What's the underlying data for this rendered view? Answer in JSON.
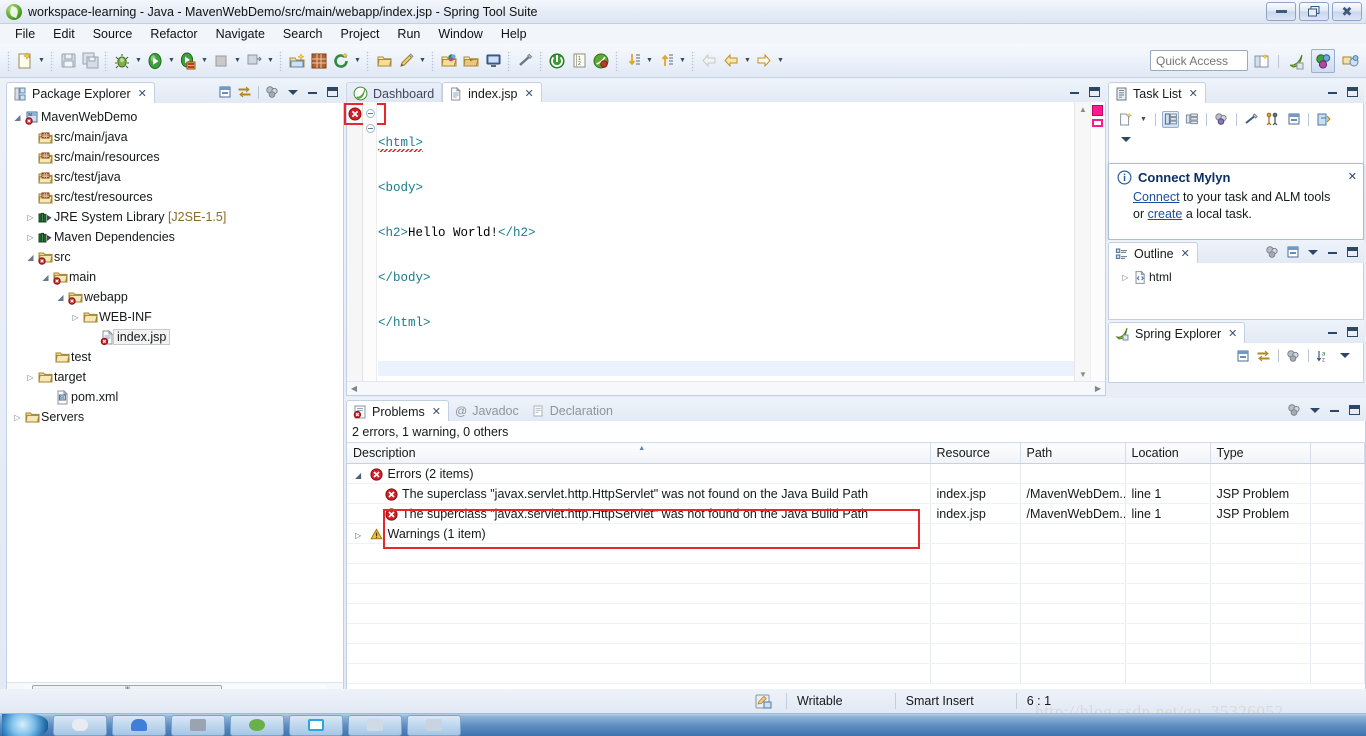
{
  "window": {
    "title": "workspace-learning - Java - MavenWebDemo/src/main/webapp/index.jsp - Spring Tool Suite",
    "app_icon": "spring-leaf-icon",
    "controls": {
      "minimize": "minimize-button",
      "maximize": "maximize-button",
      "close": "close-button"
    }
  },
  "menubar": {
    "items": [
      {
        "label": "File"
      },
      {
        "label": "Edit"
      },
      {
        "label": "Source"
      },
      {
        "label": "Refactor"
      },
      {
        "label": "Navigate"
      },
      {
        "label": "Search"
      },
      {
        "label": "Project"
      },
      {
        "label": "Run"
      },
      {
        "label": "Window"
      },
      {
        "label": "Help"
      }
    ]
  },
  "toolbar": {
    "quick_access_placeholder": "Quick Access",
    "buttons": [
      {
        "name": "new-wizard-icon",
        "has_dropdown": true
      },
      {
        "name": "save-icon",
        "has_dropdown": false
      },
      {
        "name": "save-all-icon",
        "has_dropdown": false
      },
      {
        "name": "debug-icon",
        "has_dropdown": true
      },
      {
        "name": "run-icon",
        "has_dropdown": true
      },
      {
        "name": "run-on-server-icon",
        "has_dropdown": true
      },
      {
        "name": "stop-icon",
        "has_dropdown": true
      },
      {
        "name": "publish-icon",
        "has_dropdown": true
      },
      {
        "name": "new-java-package-icon",
        "has_dropdown": false
      },
      {
        "name": "new-java-class-icon",
        "has_dropdown": false
      },
      {
        "name": "refresh-icon",
        "has_dropdown": true
      },
      {
        "name": "open-type-icon",
        "has_dropdown": false
      },
      {
        "name": "pencil-edit-icon",
        "has_dropdown": true
      },
      {
        "name": "open-resource-icon",
        "has_dropdown": false
      },
      {
        "name": "open-task-icon",
        "has_dropdown": false
      },
      {
        "name": "console-icon",
        "has_dropdown": false
      },
      {
        "name": "toggle-mark-occurrences-icon",
        "has_dropdown": false
      },
      {
        "name": "terminate-icon",
        "has_dropdown": false
      },
      {
        "name": "bookmark-icon",
        "has_dropdown": false
      },
      {
        "name": "spring-bean-icon",
        "has_dropdown": false
      },
      {
        "name": "next-annotation-icon",
        "has_dropdown": true
      },
      {
        "name": "previous-annotation-icon",
        "has_dropdown": true
      },
      {
        "name": "back-disabled-icon",
        "has_dropdown": false
      },
      {
        "name": "back-icon",
        "has_dropdown": true
      },
      {
        "name": "forward-icon",
        "has_dropdown": true
      }
    ],
    "perspectives": [
      {
        "name": "open-perspective-icon",
        "active": false
      },
      {
        "name": "spring-perspective-icon",
        "active": false
      },
      {
        "name": "java-perspective-icon",
        "active": true
      },
      {
        "name": "java-ee-perspective-icon",
        "active": false
      }
    ]
  },
  "package_explorer": {
    "title": "Package Explorer",
    "tools": [
      "collapse-all-icon",
      "link-with-editor-icon",
      "view-menu-icon",
      "minimize-icon",
      "maximize-icon"
    ],
    "tree": [
      {
        "label": "MavenWebDemo",
        "icon": "maven-project-error-icon",
        "indent": 0,
        "twist": "expanded",
        "error": true
      },
      {
        "label": "src/main/java",
        "icon": "source-folder-icon",
        "indent": 2,
        "twist": "none"
      },
      {
        "label": "src/main/resources",
        "icon": "source-folder-icon",
        "indent": 2,
        "twist": "none"
      },
      {
        "label": "src/test/java",
        "icon": "source-folder-icon",
        "indent": 2,
        "twist": "none"
      },
      {
        "label": "src/test/resources",
        "icon": "source-folder-icon",
        "indent": 2,
        "twist": "none"
      },
      {
        "label": "JRE System Library",
        "suffix": "[J2SE-1.5]",
        "icon": "library-icon",
        "indent": 1,
        "twist": "collapsed"
      },
      {
        "label": "Maven Dependencies",
        "icon": "library-icon",
        "indent": 1,
        "twist": "collapsed"
      },
      {
        "label": "src",
        "icon": "folder-error-icon",
        "indent": 1,
        "twist": "expanded",
        "error": true
      },
      {
        "label": "main",
        "icon": "folder-error-icon",
        "indent": 2,
        "twist": "expanded",
        "error": true
      },
      {
        "label": "webapp",
        "icon": "folder-error-icon",
        "indent": 3,
        "twist": "expanded",
        "error": true
      },
      {
        "label": "WEB-INF",
        "icon": "folder-icon",
        "indent": 4,
        "twist": "collapsed"
      },
      {
        "label": "index.jsp",
        "icon": "jsp-file-error-icon",
        "indent": 5,
        "twist": "none",
        "selected": true,
        "error": true
      },
      {
        "label": "test",
        "icon": "folder-icon",
        "indent": 2,
        "twist": "none"
      },
      {
        "label": "target",
        "icon": "folder-icon",
        "indent": 1,
        "twist": "collapsed"
      },
      {
        "label": "pom.xml",
        "icon": "maven-pom-icon",
        "indent": 2,
        "twist": "none"
      },
      {
        "label": "Servers",
        "icon": "folder-icon",
        "indent": 0,
        "twist": "collapsed"
      }
    ]
  },
  "editor": {
    "tabs": [
      {
        "label": "Dashboard",
        "icon": "spring-dashboard-icon",
        "active": false,
        "closable": false
      },
      {
        "label": "index.jsp",
        "icon": "jsp-file-icon",
        "active": true,
        "closable": true
      }
    ],
    "tools": [
      "minimize-icon",
      "maximize-icon"
    ],
    "gutter_marker": "error-marker-icon",
    "code_lines": [
      {
        "text": "<html>",
        "type": "tag",
        "squiggly": true,
        "fold": true
      },
      {
        "text": "<body>",
        "type": "tag",
        "squiggly": false,
        "fold": true
      },
      {
        "text": "<h2>Hello World!</h2>",
        "type": "mixed",
        "squiggly": false,
        "fold": false
      },
      {
        "text": "</body>",
        "type": "tag",
        "squiggly": false,
        "fold": false
      },
      {
        "text": "</html>",
        "type": "tag",
        "squiggly": false,
        "fold": false
      }
    ],
    "code_segments_line3": [
      {
        "t": "<h2>",
        "cls": "tag"
      },
      {
        "t": "Hello World!",
        "cls": "txt"
      },
      {
        "t": "</h2>",
        "cls": "tag"
      }
    ],
    "overview_markers": [
      "error-overview-marker",
      "changed-overview-marker"
    ],
    "tag_color": "#1a7a8c",
    "error_highlight_color": "#e8262b"
  },
  "problems": {
    "tabs": [
      {
        "label": "Problems",
        "icon": "problems-icon",
        "active": true,
        "closable": true
      },
      {
        "label": "Javadoc",
        "icon": "javadoc-icon",
        "active": false,
        "closable": false
      },
      {
        "label": "Declaration",
        "icon": "declaration-icon",
        "active": false,
        "closable": false
      }
    ],
    "tools": [
      "view-menu-icon",
      "minimize-icon",
      "maximize-icon"
    ],
    "summary": "2 errors, 1 warning, 0 others",
    "columns": [
      "Description",
      "Resource",
      "Path",
      "Location",
      "Type"
    ],
    "sorted_column": "Description",
    "rows": [
      {
        "kind": "group",
        "icon": "error-icon",
        "twist": "expanded",
        "description": "Errors (2 items)",
        "resource": "",
        "path": "",
        "location": "",
        "type": ""
      },
      {
        "kind": "item",
        "icon": "error-icon",
        "description": "The superclass \"javax.servlet.http.HttpServlet\" was not found on the Java Build Path",
        "resource": "index.jsp",
        "path": "/MavenWebDem...",
        "location": "line 1",
        "type": "JSP Problem",
        "highlighted": true
      },
      {
        "kind": "item",
        "icon": "error-icon",
        "description": "The superclass \"javax.servlet.http.HttpServlet\" was not found on the Java Build Path",
        "resource": "index.jsp",
        "path": "/MavenWebDem...",
        "location": "line 1",
        "type": "JSP Problem",
        "highlighted": true
      },
      {
        "kind": "group",
        "icon": "warning-icon",
        "twist": "collapsed",
        "description": "Warnings (1 item)",
        "resource": "",
        "path": "",
        "location": "",
        "type": ""
      }
    ]
  },
  "task_list": {
    "title": "Task List",
    "tools": [
      "new-task-icon",
      "categorized-presentation-icon",
      "scheduled-presentation-icon",
      "focus-on-workweek-icon",
      "collapse-all-icon",
      "synchronize-changed-icon",
      "view-menu-icon",
      "minimize-icon",
      "maximize-icon"
    ],
    "find_placeholder": ""
  },
  "mylyn_notice": {
    "icon": "info-icon",
    "title": "Connect Mylyn",
    "link1": "Connect",
    "text1": " to your task and ALM tools",
    "text2": "or ",
    "link2": "create",
    "text3": " a local task.",
    "close": "close-icon"
  },
  "outline": {
    "title": "Outline",
    "tools": [
      "sort-icon",
      "collapse-all-icon",
      "view-menu-icon",
      "minimize-icon",
      "maximize-icon"
    ],
    "items": [
      {
        "label": "html",
        "icon": "html-element-icon",
        "twist": "collapsed"
      }
    ]
  },
  "spring_explorer": {
    "title": "Spring Explorer",
    "tools": [
      "collapse-all-icon",
      "link-with-editor-icon",
      "filter-icon",
      "sort-az-icon",
      "view-menu-icon",
      "minimize-icon",
      "maximize-icon"
    ]
  },
  "status_bar": {
    "icon": "writable-indicator-icon",
    "writable": "Writable",
    "insert_mode": "Smart Insert",
    "cursor_position": "6 : 1"
  },
  "watermark": "http://blog.csdn.net/qq_35326052",
  "taskbar": {
    "start": "start-button",
    "items": [
      "taskbar-item-1",
      "taskbar-item-2",
      "taskbar-item-3",
      "taskbar-item-4",
      "taskbar-item-5",
      "taskbar-item-6",
      "taskbar-item-7"
    ]
  }
}
